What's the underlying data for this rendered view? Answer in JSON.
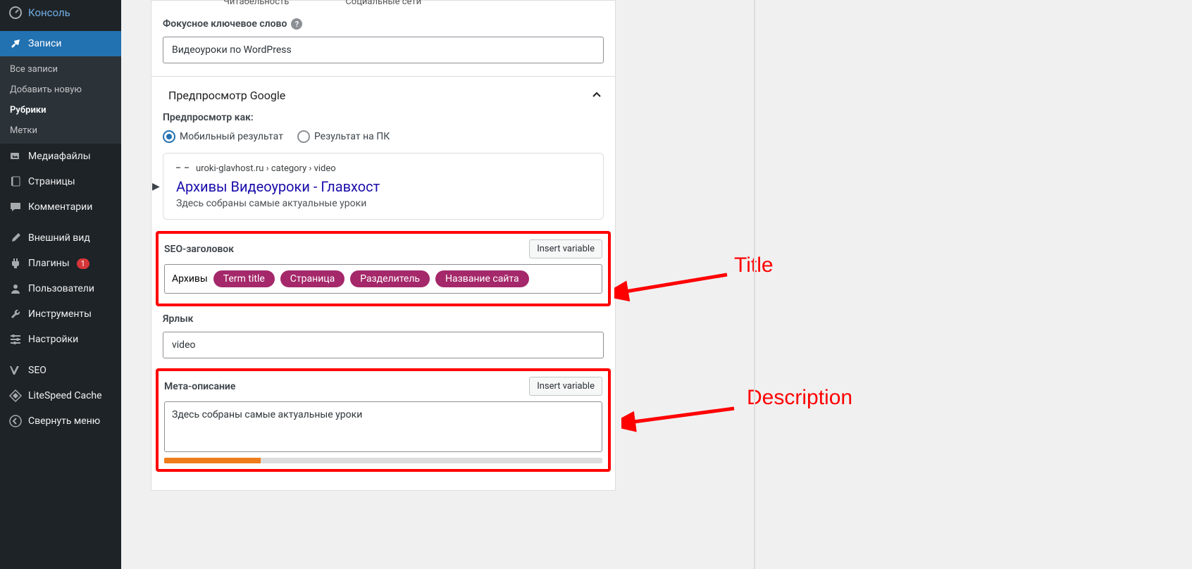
{
  "sidebar": {
    "console": "Консоль",
    "posts": "Записи",
    "posts_sub": {
      "all": "Все записи",
      "add": "Добавить новую",
      "cats": "Рубрики",
      "tags": "Метки"
    },
    "media": "Медиафайлы",
    "pages": "Страницы",
    "comments": "Комментарии",
    "appearance": "Внешний вид",
    "plugins": "Плагины",
    "plugins_badge": "1",
    "users": "Пользователи",
    "tools": "Инструменты",
    "settings": "Настройки",
    "seo": "SEO",
    "litespeed": "LiteSpeed Cache",
    "collapse": "Свернуть меню"
  },
  "tabs": {
    "readability": "Читабельность",
    "social": "Социальные сети"
  },
  "focus": {
    "label": "Фокусное ключевое слово",
    "value": "Видеоуроки по WordPress"
  },
  "gprev": {
    "title": "Предпросмотр Google",
    "as": "Предпросмотр как:",
    "mobile": "Мобильный результат",
    "desktop": "Результат на ПК",
    "url": "uroki-glavhost.ru › category › video",
    "link": "Архивы Видеоуроки - Главхост",
    "desc": "Здесь собраны самые актуальные уроки"
  },
  "seo_title": {
    "label": "SEO-заголовок",
    "insert": "Insert variable",
    "prefix": "Архивы",
    "pills": [
      "Term title",
      "Страница",
      "Разделитель",
      "Название сайта"
    ]
  },
  "slug": {
    "label": "Ярлык",
    "value": "video"
  },
  "meta": {
    "label": "Мета-описание",
    "insert": "Insert variable",
    "value": "Здесь собраны самые актуальные уроки"
  },
  "anno": {
    "title": "Title",
    "desc": "Description"
  }
}
